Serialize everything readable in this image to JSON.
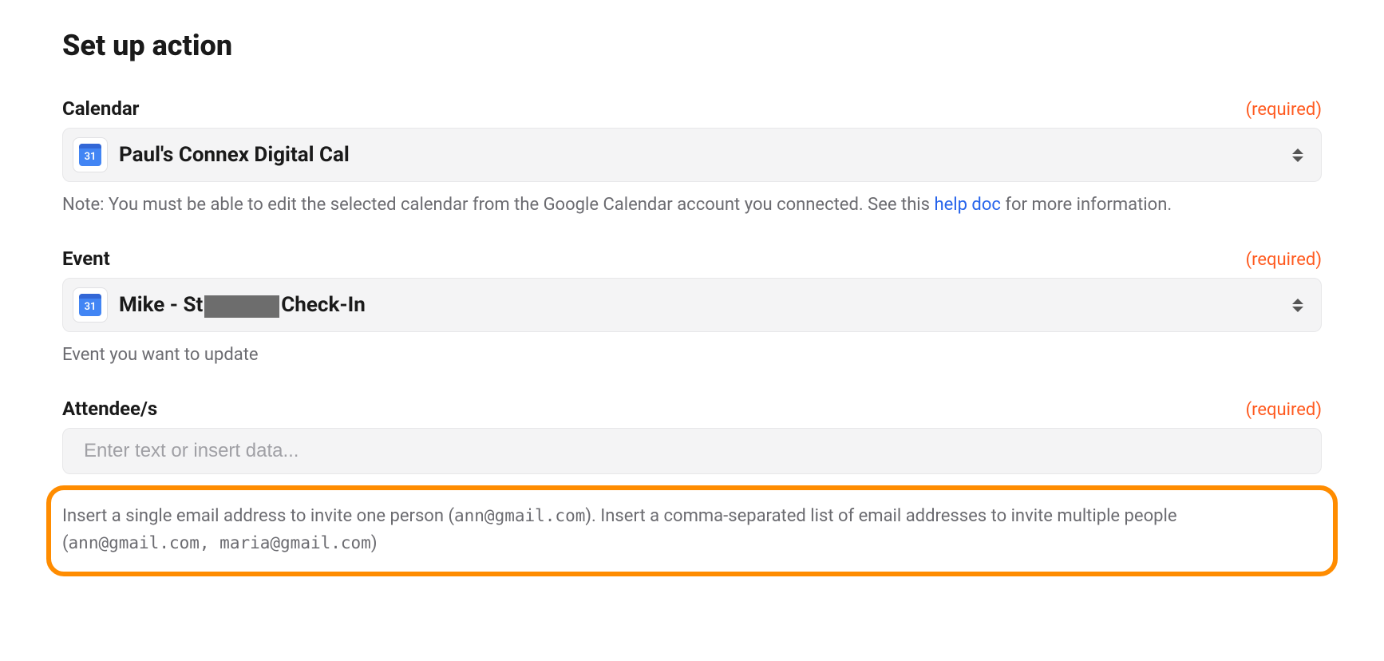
{
  "title": "Set up action",
  "required_label": "(required)",
  "calendar": {
    "label": "Calendar",
    "icon_text": "31",
    "value": "Paul's Connex Digital Cal",
    "help_before": "Note: You must be able to edit the selected calendar from the Google Calendar account you connected. See this ",
    "help_link": "help doc",
    "help_after": " for more information."
  },
  "event": {
    "label": "Event",
    "icon_text": "31",
    "value_prefix": "Mike - St",
    "value_suffix": "Check-In",
    "help": "Event you want to update"
  },
  "attendees": {
    "label": "Attendee/s",
    "placeholder": "Enter text or insert data...",
    "help_1": "Insert a single email address to invite one person (",
    "help_code_1": "ann@gmail.com",
    "help_2": "). Insert a comma-separated list of email addresses to invite multiple people (",
    "help_code_2": "ann@gmail.com, maria@gmail.com",
    "help_3": ")"
  }
}
